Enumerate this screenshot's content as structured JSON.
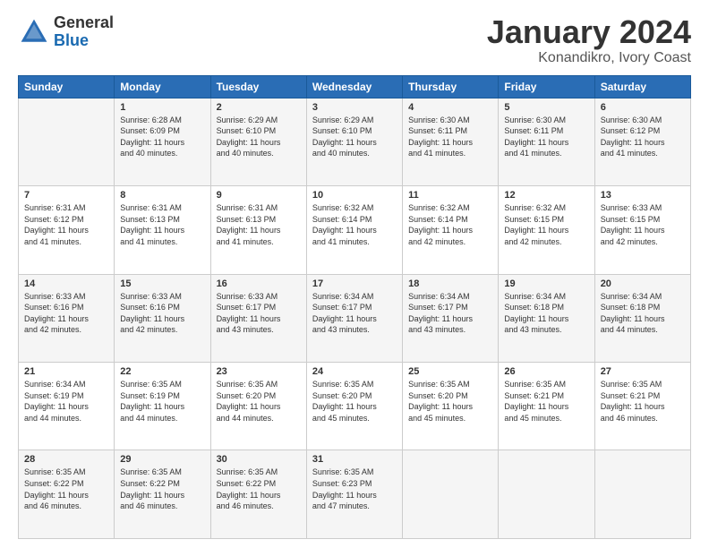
{
  "header": {
    "logo_general": "General",
    "logo_blue": "Blue",
    "month_title": "January 2024",
    "location": "Konandikro, Ivory Coast"
  },
  "days_of_week": [
    "Sunday",
    "Monday",
    "Tuesday",
    "Wednesday",
    "Thursday",
    "Friday",
    "Saturday"
  ],
  "weeks": [
    [
      {
        "day": "",
        "info": ""
      },
      {
        "day": "1",
        "info": "Sunrise: 6:28 AM\nSunset: 6:09 PM\nDaylight: 11 hours\nand 40 minutes."
      },
      {
        "day": "2",
        "info": "Sunrise: 6:29 AM\nSunset: 6:10 PM\nDaylight: 11 hours\nand 40 minutes."
      },
      {
        "day": "3",
        "info": "Sunrise: 6:29 AM\nSunset: 6:10 PM\nDaylight: 11 hours\nand 40 minutes."
      },
      {
        "day": "4",
        "info": "Sunrise: 6:30 AM\nSunset: 6:11 PM\nDaylight: 11 hours\nand 41 minutes."
      },
      {
        "day": "5",
        "info": "Sunrise: 6:30 AM\nSunset: 6:11 PM\nDaylight: 11 hours\nand 41 minutes."
      },
      {
        "day": "6",
        "info": "Sunrise: 6:30 AM\nSunset: 6:12 PM\nDaylight: 11 hours\nand 41 minutes."
      }
    ],
    [
      {
        "day": "7",
        "info": "Sunrise: 6:31 AM\nSunset: 6:12 PM\nDaylight: 11 hours\nand 41 minutes."
      },
      {
        "day": "8",
        "info": "Sunrise: 6:31 AM\nSunset: 6:13 PM\nDaylight: 11 hours\nand 41 minutes."
      },
      {
        "day": "9",
        "info": "Sunrise: 6:31 AM\nSunset: 6:13 PM\nDaylight: 11 hours\nand 41 minutes."
      },
      {
        "day": "10",
        "info": "Sunrise: 6:32 AM\nSunset: 6:14 PM\nDaylight: 11 hours\nand 41 minutes."
      },
      {
        "day": "11",
        "info": "Sunrise: 6:32 AM\nSunset: 6:14 PM\nDaylight: 11 hours\nand 42 minutes."
      },
      {
        "day": "12",
        "info": "Sunrise: 6:32 AM\nSunset: 6:15 PM\nDaylight: 11 hours\nand 42 minutes."
      },
      {
        "day": "13",
        "info": "Sunrise: 6:33 AM\nSunset: 6:15 PM\nDaylight: 11 hours\nand 42 minutes."
      }
    ],
    [
      {
        "day": "14",
        "info": "Sunrise: 6:33 AM\nSunset: 6:16 PM\nDaylight: 11 hours\nand 42 minutes."
      },
      {
        "day": "15",
        "info": "Sunrise: 6:33 AM\nSunset: 6:16 PM\nDaylight: 11 hours\nand 42 minutes."
      },
      {
        "day": "16",
        "info": "Sunrise: 6:33 AM\nSunset: 6:17 PM\nDaylight: 11 hours\nand 43 minutes."
      },
      {
        "day": "17",
        "info": "Sunrise: 6:34 AM\nSunset: 6:17 PM\nDaylight: 11 hours\nand 43 minutes."
      },
      {
        "day": "18",
        "info": "Sunrise: 6:34 AM\nSunset: 6:17 PM\nDaylight: 11 hours\nand 43 minutes."
      },
      {
        "day": "19",
        "info": "Sunrise: 6:34 AM\nSunset: 6:18 PM\nDaylight: 11 hours\nand 43 minutes."
      },
      {
        "day": "20",
        "info": "Sunrise: 6:34 AM\nSunset: 6:18 PM\nDaylight: 11 hours\nand 44 minutes."
      }
    ],
    [
      {
        "day": "21",
        "info": "Sunrise: 6:34 AM\nSunset: 6:19 PM\nDaylight: 11 hours\nand 44 minutes."
      },
      {
        "day": "22",
        "info": "Sunrise: 6:35 AM\nSunset: 6:19 PM\nDaylight: 11 hours\nand 44 minutes."
      },
      {
        "day": "23",
        "info": "Sunrise: 6:35 AM\nSunset: 6:20 PM\nDaylight: 11 hours\nand 44 minutes."
      },
      {
        "day": "24",
        "info": "Sunrise: 6:35 AM\nSunset: 6:20 PM\nDaylight: 11 hours\nand 45 minutes."
      },
      {
        "day": "25",
        "info": "Sunrise: 6:35 AM\nSunset: 6:20 PM\nDaylight: 11 hours\nand 45 minutes."
      },
      {
        "day": "26",
        "info": "Sunrise: 6:35 AM\nSunset: 6:21 PM\nDaylight: 11 hours\nand 45 minutes."
      },
      {
        "day": "27",
        "info": "Sunrise: 6:35 AM\nSunset: 6:21 PM\nDaylight: 11 hours\nand 46 minutes."
      }
    ],
    [
      {
        "day": "28",
        "info": "Sunrise: 6:35 AM\nSunset: 6:22 PM\nDaylight: 11 hours\nand 46 minutes."
      },
      {
        "day": "29",
        "info": "Sunrise: 6:35 AM\nSunset: 6:22 PM\nDaylight: 11 hours\nand 46 minutes."
      },
      {
        "day": "30",
        "info": "Sunrise: 6:35 AM\nSunset: 6:22 PM\nDaylight: 11 hours\nand 46 minutes."
      },
      {
        "day": "31",
        "info": "Sunrise: 6:35 AM\nSunset: 6:23 PM\nDaylight: 11 hours\nand 47 minutes."
      },
      {
        "day": "",
        "info": ""
      },
      {
        "day": "",
        "info": ""
      },
      {
        "day": "",
        "info": ""
      }
    ]
  ]
}
